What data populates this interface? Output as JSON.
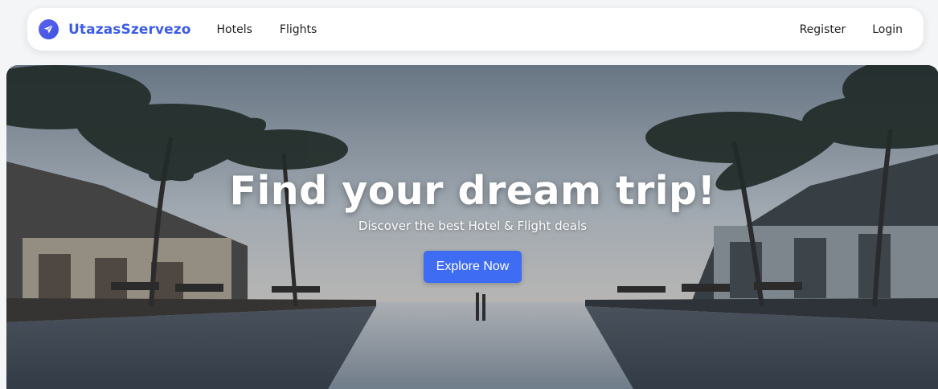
{
  "navbar": {
    "brand_name": "UtazasSzervezo",
    "brand_icon": "airplane-icon",
    "left_links": [
      "Hotels",
      "Flights"
    ],
    "right_links": [
      "Register",
      "Login"
    ]
  },
  "hero": {
    "title": "Find your dream trip!",
    "subtitle": "Discover the best Hotel & Flight deals",
    "button_label": "Explore Now"
  },
  "colors": {
    "brand": "#3d5ce6",
    "button": "#3e6cf2"
  }
}
